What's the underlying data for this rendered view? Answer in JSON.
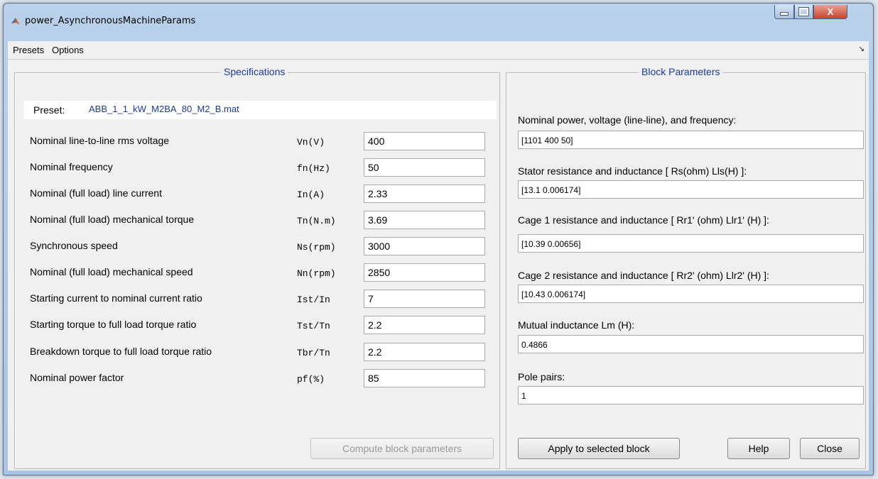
{
  "window": {
    "title": "power_AsynchronousMachineParams",
    "close_glyph": "X"
  },
  "menu": {
    "presets": "Presets",
    "options": "Options",
    "arrow": "↘"
  },
  "spec": {
    "title": "Specifications",
    "preset_label": "Preset:",
    "preset_value": "ABB_1_1_kW_M2BA_80_M2_B.mat",
    "rows": [
      {
        "label": "Nominal line-to-line rms voltage",
        "symbol": "Vn(V)",
        "value": "400"
      },
      {
        "label": "Nominal frequency",
        "symbol": "fn(Hz)",
        "value": "50"
      },
      {
        "label": "Nominal (full load) line current",
        "symbol": "In(A)",
        "value": "2.33"
      },
      {
        "label": "Nominal (full load) mechanical torque",
        "symbol": "Tn(N.m)",
        "value": "3.69"
      },
      {
        "label": "Synchronous speed",
        "symbol": "Ns(rpm)",
        "value": "3000"
      },
      {
        "label": "Nominal (full load) mechanical speed",
        "symbol": "Nn(rpm)",
        "value": "2850"
      },
      {
        "label": "Starting current to nominal current ratio",
        "symbol": "Ist/In",
        "value": "7"
      },
      {
        "label": "Starting torque to full load torque ratio",
        "symbol": "Tst/Tn",
        "value": "2.2"
      },
      {
        "label": "Breakdown torque to full load torque ratio",
        "symbol": "Tbr/Tn",
        "value": "2.2"
      },
      {
        "label": "Nominal power factor",
        "symbol": "pf(%)",
        "value": "85"
      }
    ],
    "compute_label": "Compute block parameters"
  },
  "block": {
    "title": "Block Parameters",
    "fields": [
      {
        "label": "Nominal power, voltage (line-line), and frequency:",
        "value": "[1101 400 50]"
      },
      {
        "label": "Stator resistance and inductance [ Rs(ohm)  Lls(H) ]:",
        "value": "[13.1 0.006174]"
      },
      {
        "label": "Cage 1 resistance and inductance  [ Rr1' (ohm)  Llr1' (H) ]:",
        "value": "[10.39 0.00656]"
      },
      {
        "label": "Cage 2 resistance and inductance  [ Rr2' (ohm)  Llr2' (H) ]:",
        "value": "[10.43 0.006174]"
      },
      {
        "label": "Mutual inductance Lm (H):",
        "value": "0.4866"
      },
      {
        "label": "Pole pairs:",
        "value": "1"
      }
    ],
    "apply_label": "Apply to selected block",
    "help_label": "Help",
    "close_label": "Close"
  }
}
